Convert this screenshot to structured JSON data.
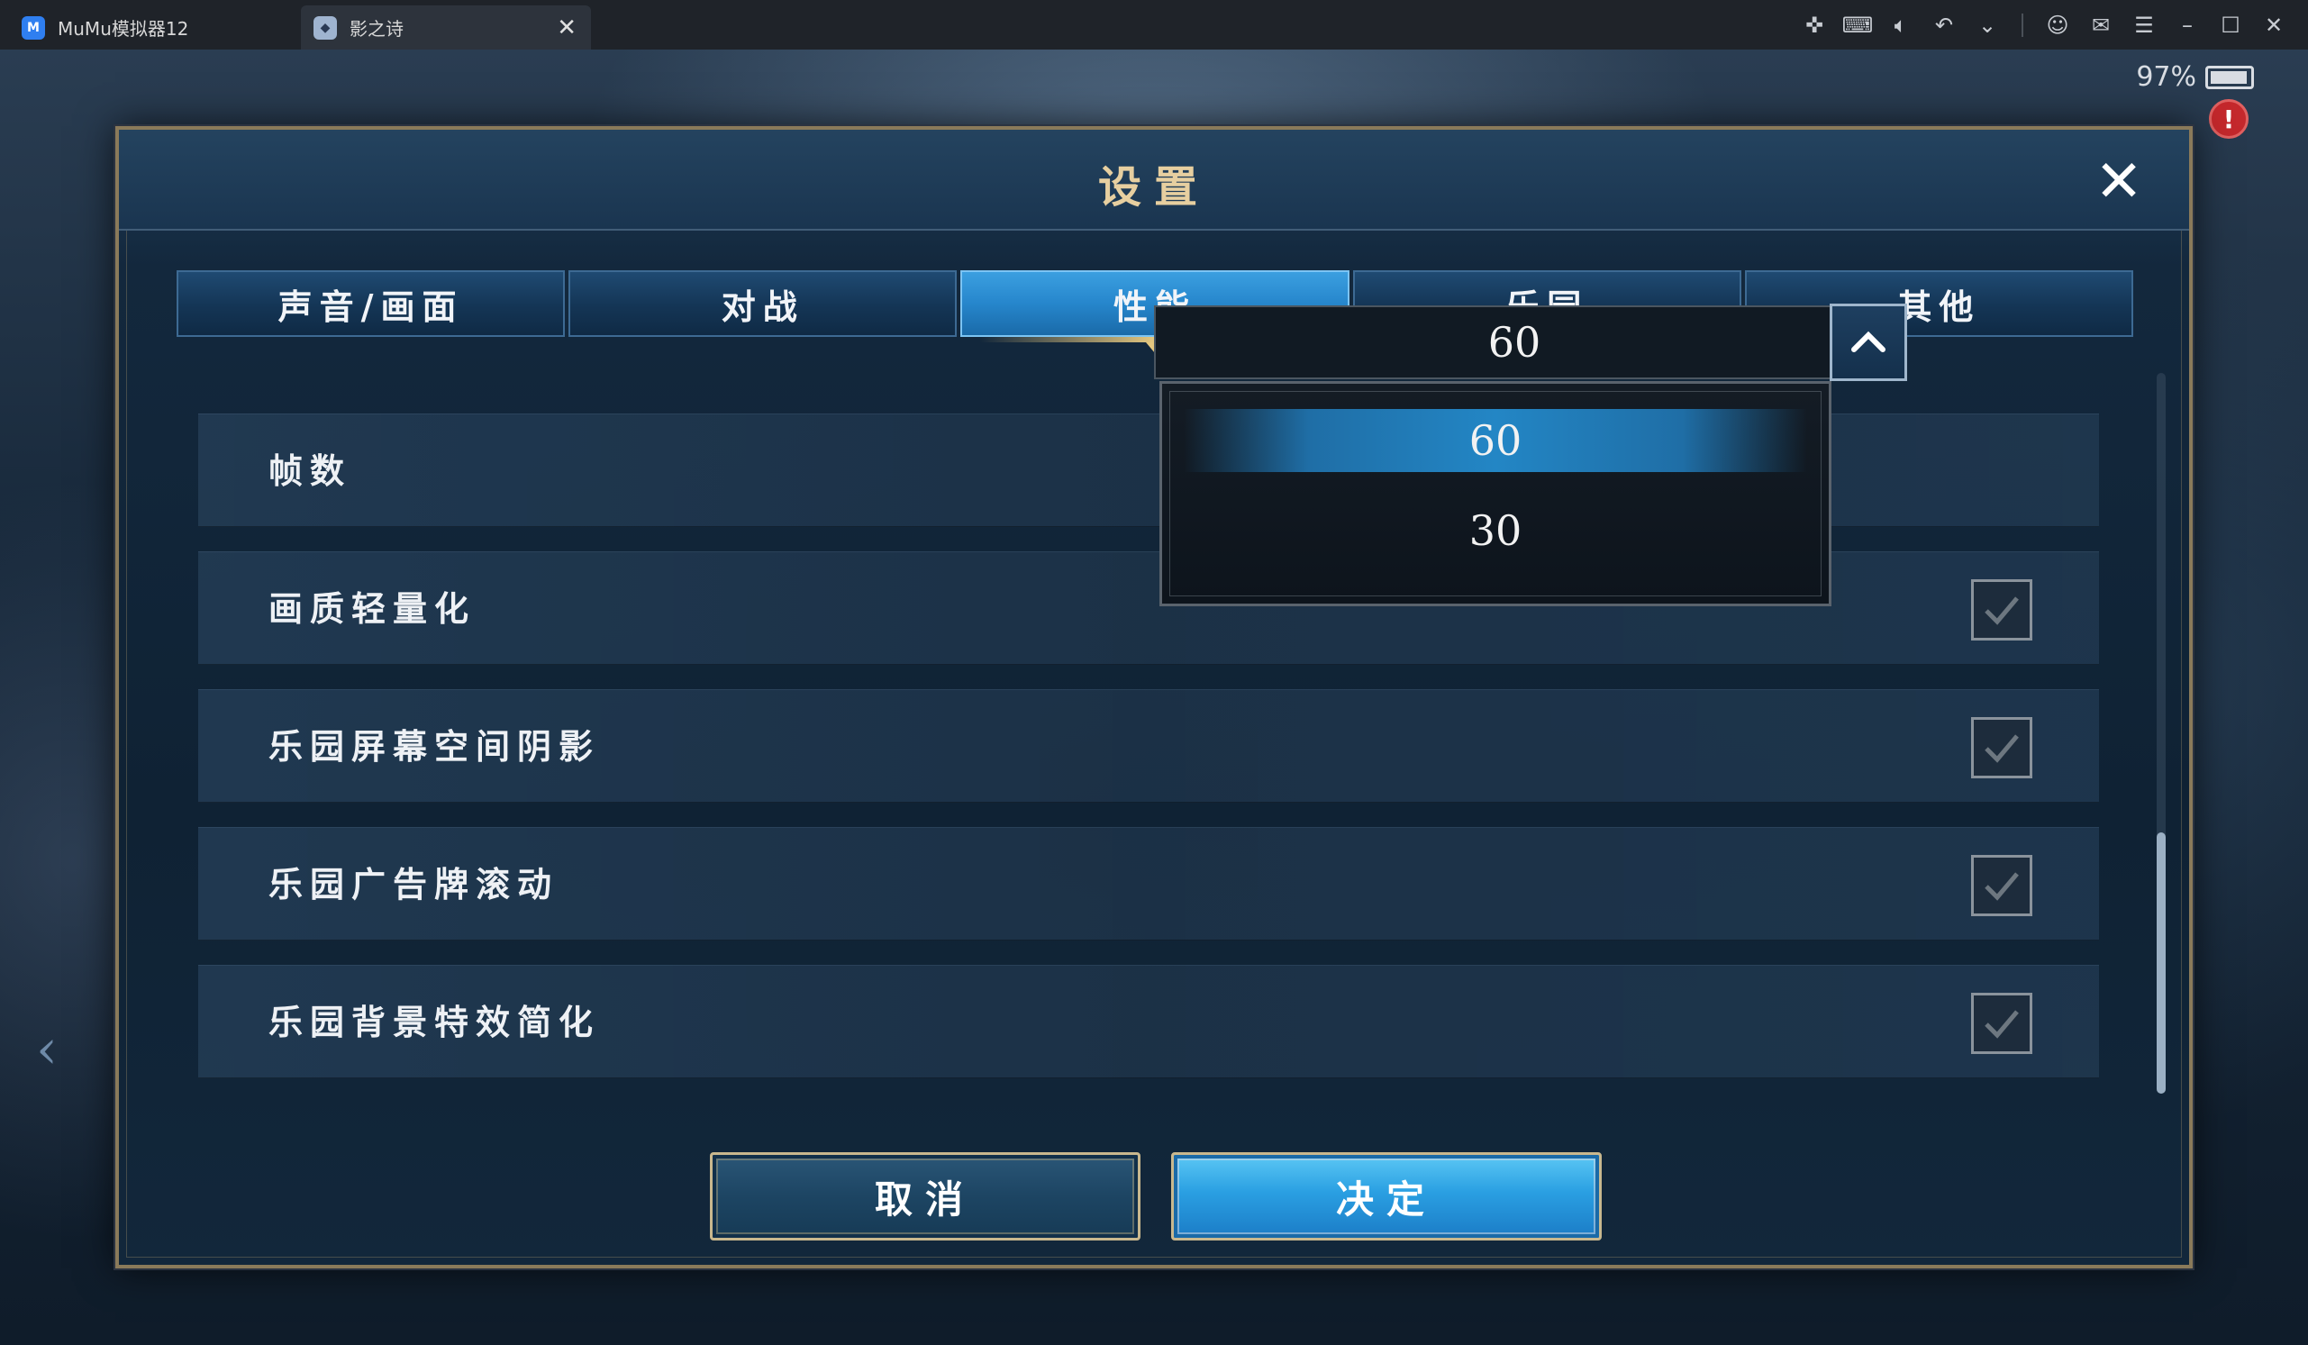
{
  "emulator": {
    "app_tab_label": "MuMu模拟器12",
    "app_tab_icon_text": "M",
    "game_tab_label": "影之诗",
    "game_tab_close": "✕",
    "toolbar_icons": [
      "gamepad-icon",
      "keyboard-icon",
      "volume-icon",
      "rotate-back-icon",
      "chevron-down-icon",
      "user-icon",
      "mail-icon",
      "menu-icon",
      "minimize-icon",
      "maximize-icon",
      "close-icon"
    ]
  },
  "status": {
    "battery_percent": "97%",
    "alert_badge": "!"
  },
  "dialog": {
    "title": "设置",
    "close_glyph": "✕",
    "tabs": [
      {
        "label": "声音/画面",
        "active": false
      },
      {
        "label": "对战",
        "active": false
      },
      {
        "label": "性能",
        "active": true
      },
      {
        "label": "乐园",
        "active": false
      },
      {
        "label": "其他",
        "active": false
      }
    ],
    "settings": [
      {
        "label": "帧数",
        "control": "select",
        "value": "60"
      },
      {
        "label": "画质轻量化",
        "control": "checkbox",
        "checked": true
      },
      {
        "label": "乐园屏幕空间阴影",
        "control": "checkbox",
        "checked": true
      },
      {
        "label": "乐园广告牌滚动",
        "control": "checkbox",
        "checked": true
      },
      {
        "label": "乐园背景特效简化",
        "control": "checkbox",
        "checked": true
      }
    ],
    "framerate_dropdown": {
      "options": [
        "60",
        "30"
      ],
      "selected": "60",
      "open": true
    },
    "buttons": {
      "cancel_label": "取消",
      "confirm_label": "决定"
    }
  },
  "colors": {
    "accent_gold": "#e7cfa0",
    "tab_active": "#2686cc",
    "panel": "#0f2234"
  }
}
